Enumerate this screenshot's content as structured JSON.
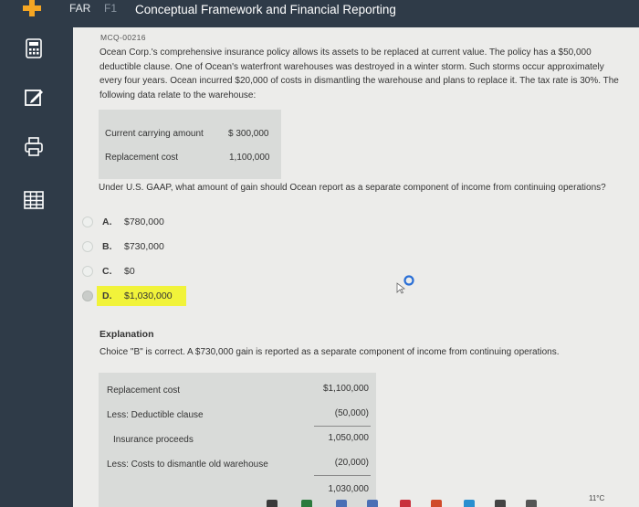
{
  "header": {
    "tab_far": "FAR",
    "tab_f1": "F1",
    "title": "Conceptual Framework and Financial Reporting"
  },
  "sidebar": {
    "items": [
      {
        "icon": "calculator-icon"
      },
      {
        "icon": "edit-icon"
      },
      {
        "icon": "print-icon"
      },
      {
        "icon": "spreadsheet-icon"
      }
    ]
  },
  "question": {
    "id": "MCQ-00216",
    "text": "Ocean Corp.'s comprehensive insurance policy allows its assets to be replaced at current value. The policy has a $50,000 deductible clause. One of Ocean's waterfront warehouses was destroyed in a winter storm. Such storms occur approximately every four years. Ocean incurred $20,000 of costs in dismantling the warehouse and plans to replace it. The tax rate is 30%. The following data relate to the warehouse:",
    "data_rows": [
      {
        "label": "Current carrying amount",
        "value": "$ 300,000"
      },
      {
        "label": "Replacement cost",
        "value": "1,100,000"
      }
    ],
    "prompt": "Under U.S. GAAP, what amount of gain should Ocean report as a separate component of income from continuing operations?"
  },
  "choices": [
    {
      "letter": "A.",
      "text": "$780,000",
      "selected": false
    },
    {
      "letter": "B.",
      "text": "$730,000",
      "selected": false
    },
    {
      "letter": "C.",
      "text": "$0",
      "selected": false
    },
    {
      "letter": "D.",
      "text": "$1,030,000",
      "selected": true
    }
  ],
  "explanation": {
    "title": "Explanation",
    "text": "Choice \"B\" is correct. A $730,000 gain is reported as a separate component of income from continuing operations.",
    "rows": [
      {
        "label": "Replacement cost",
        "value": "$1,100,000"
      },
      {
        "label": "Less: Deductible clause",
        "value": "(50,000)"
      },
      {
        "label": "Insurance proceeds",
        "value": "1,050,000"
      },
      {
        "label": "Less: Costs to dismantle old warehouse",
        "value": "(20,000)"
      },
      {
        "label": "",
        "value": "1,030,000"
      }
    ]
  },
  "taskbar": {
    "temperature": "11°C"
  },
  "colors": {
    "sidebar": "#2f3b48",
    "accent_plus": "#f5a623",
    "highlight": "#f1f33a"
  }
}
